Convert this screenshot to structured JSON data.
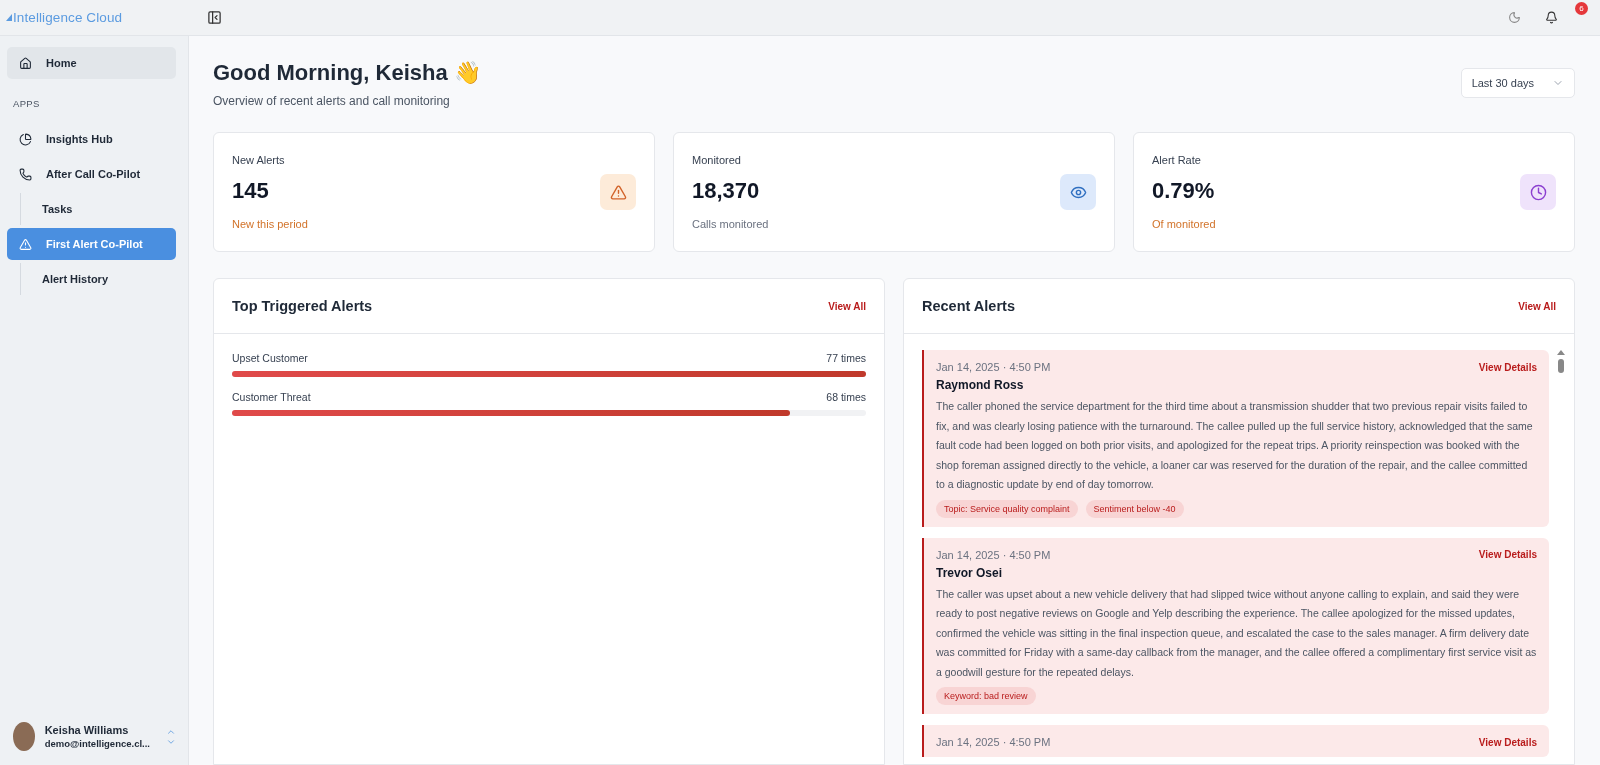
{
  "brand": {
    "name": "Intelligence Cloud"
  },
  "header": {
    "notification_count": "6"
  },
  "sidebar": {
    "items": [
      {
        "label": "Home",
        "kind": "home",
        "selected": false,
        "hovered": true
      }
    ],
    "section": "APPS",
    "apps": [
      {
        "label": "Insights Hub",
        "kind": "insights",
        "selected": false,
        "hovered": false
      },
      {
        "label": "After Call Co-Pilot",
        "kind": "calls",
        "selected": false,
        "hovered": false,
        "children": [
          {
            "label": "Tasks",
            "selected": false
          }
        ]
      },
      {
        "label": "First Alert Co-Pilot",
        "kind": "alerts",
        "selected": true,
        "hovered": false,
        "children": [
          {
            "label": "Alert History",
            "selected": false
          }
        ]
      }
    ],
    "user": {
      "name": "Keisha Williams",
      "email": "demo@intelligence.cl..."
    }
  },
  "page": {
    "title": "Good Morning, Keisha 👋",
    "subtitle": "Overview of recent alerts and call monitoring",
    "range": "Last 30 days"
  },
  "stats": [
    {
      "label": "New Alerts",
      "value": "145",
      "note": "New this period",
      "highlight": true,
      "kind": "alert"
    },
    {
      "label": "Monitored",
      "value": "18,370",
      "note": "Calls monitored",
      "highlight": false,
      "kind": "eye"
    },
    {
      "label": "Alert Rate",
      "value": "0.79%",
      "note": "Of monitored",
      "highlight": true,
      "kind": "clock"
    }
  ],
  "top_alerts": {
    "title": "Top Triggered Alerts",
    "link": "View All",
    "items": [
      {
        "name": "Upset Customer",
        "count": "77 times",
        "level": 1.0
      },
      {
        "name": "Customer Threat",
        "count": "68 times",
        "level": 0.88
      }
    ]
  },
  "recent_alerts": {
    "title": "Recent Alerts",
    "link": "View All",
    "items": [
      {
        "date": "Jan 14, 2025 · 4:50 PM",
        "link": "View Details",
        "name": "Raymond Ross",
        "text": "The caller phoned the service department for the third time about a transmission shudder that two previous repair visits failed to fix, and was clearly losing patience with the turnaround. The callee pulled up the full service history, acknowledged that the same fault code had been logged on both prior visits, and apologized for the repeat trips. A priority reinspection was booked with the shop foreman assigned directly to the vehicle, a loaner car was reserved for the duration of the repair, and the callee committed to a diagnostic update by end of day tomorrow.",
        "tags": [
          "Topic: Service quality complaint",
          "Sentiment below -40"
        ]
      },
      {
        "date": "Jan 14, 2025 · 4:50 PM",
        "link": "View Details",
        "name": "Trevor Osei",
        "text": "The caller was upset about a new vehicle delivery that had slipped twice without anyone calling to explain, and said they were ready to post negative reviews on Google and Yelp describing the experience. The callee apologized for the missed updates, confirmed the vehicle was sitting in the final inspection queue, and escalated the case to the sales manager. A firm delivery date was committed for Friday with a same-day callback from the manager, and the callee offered a complimentary first service visit as a goodwill gesture for the repeated delays.",
        "tags": [
          "Keyword: bad review"
        ]
      },
      {
        "date": "Jan 14, 2025 · 4:50 PM",
        "link": "View Details"
      }
    ]
  }
}
